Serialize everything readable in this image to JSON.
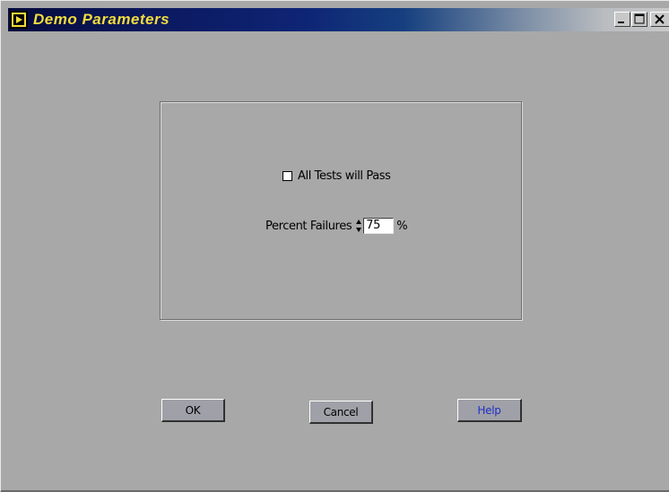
{
  "window": {
    "title": "Demo Parameters",
    "icon": "run-arrow-icon",
    "controls": [
      "minimize-icon",
      "maximize-icon",
      "close-icon"
    ]
  },
  "form": {
    "checkbox_label": "All Tests will Pass",
    "checkbox_checked": false,
    "percent_label": "Percent Failures",
    "percent_value": "75",
    "percent_unit": "%"
  },
  "buttons": {
    "ok": "OK",
    "cancel": "Cancel",
    "help": "Help"
  },
  "colors": {
    "title_text": "#f2dc3e",
    "help_text": "#1e2fc8",
    "background": "#a8a8a8"
  }
}
